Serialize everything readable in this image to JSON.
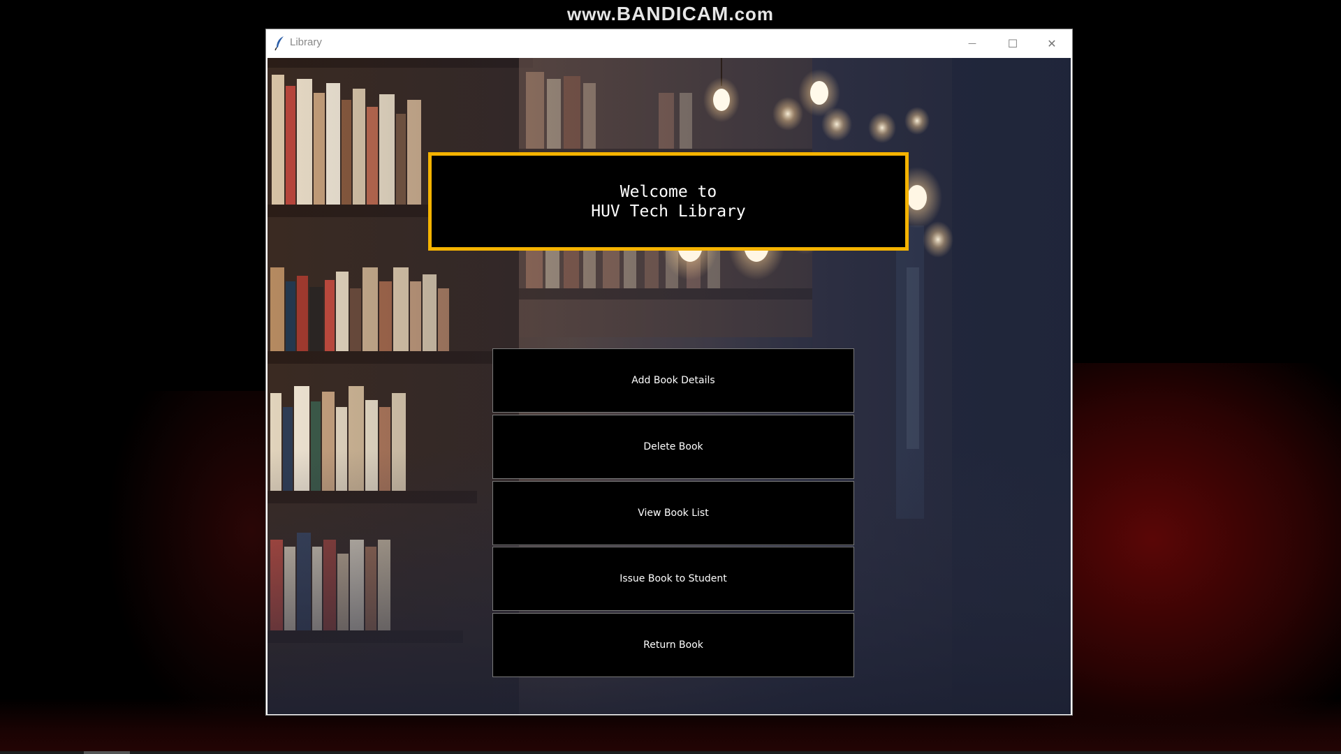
{
  "watermark": {
    "prefix": "www.",
    "brand": "BANDICAM",
    "suffix": ".com"
  },
  "window": {
    "title": "Library",
    "controls": {
      "minimize": "—",
      "maximize": "☐",
      "close": "✕"
    }
  },
  "heading": {
    "text": "Welcome to\nHUV Tech Library",
    "border_color": "#f5b300"
  },
  "menu": {
    "buttons": [
      {
        "label": "Add Book Details"
      },
      {
        "label": "Delete Book"
      },
      {
        "label": "View Book List"
      },
      {
        "label": "Issue Book to Student"
      },
      {
        "label": "Return Book"
      }
    ]
  },
  "icons": {
    "app": "feather-icon"
  }
}
